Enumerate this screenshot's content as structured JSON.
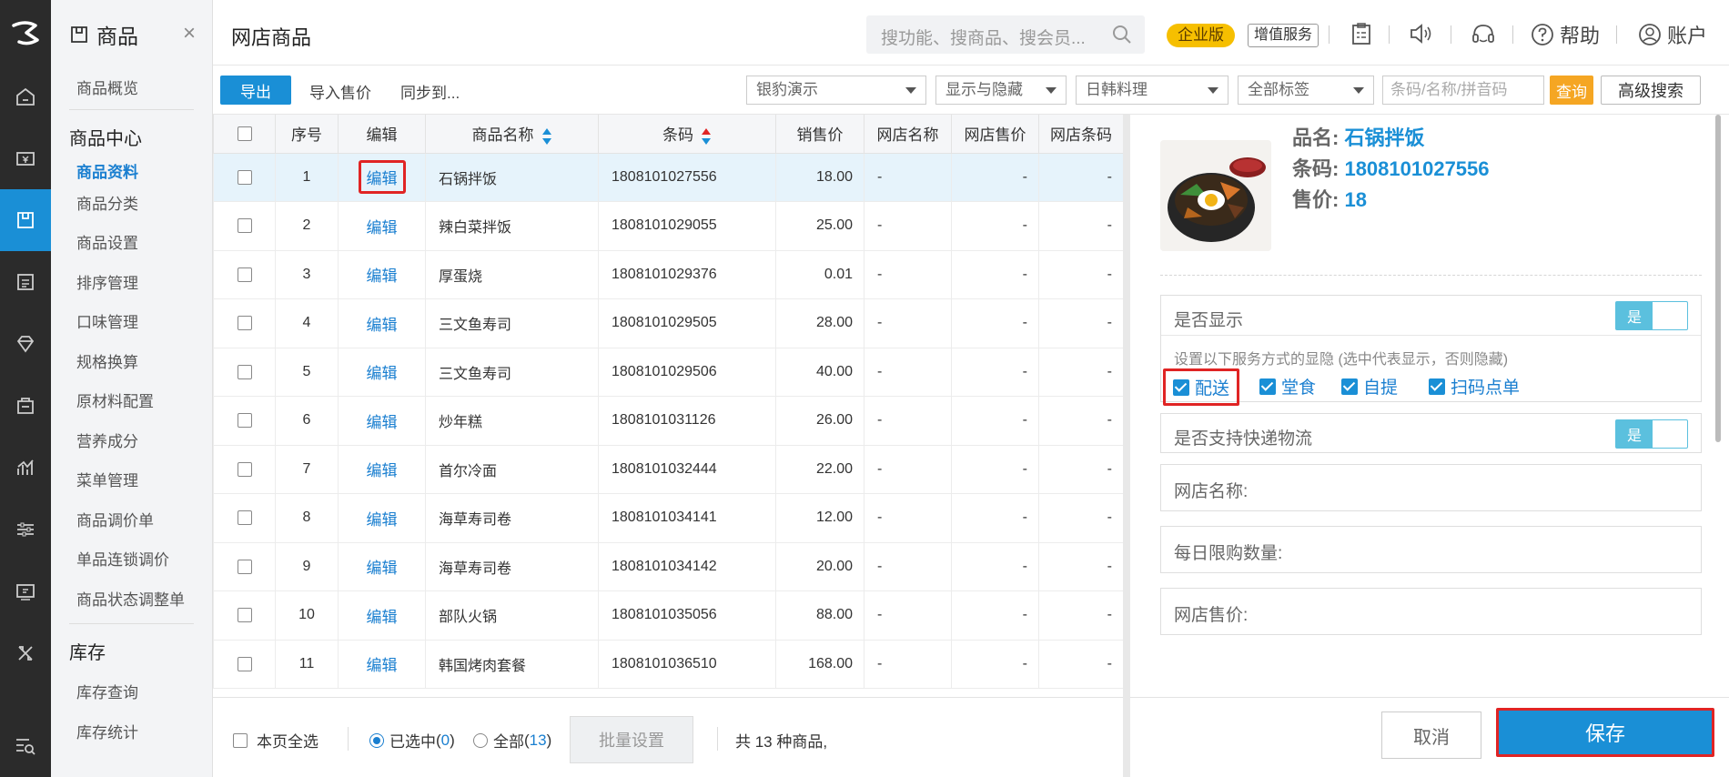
{
  "sidebar": {
    "module_title": "商品",
    "close_glyph": "×",
    "overview": "商品概览",
    "section_goods_center": "商品中心",
    "items": [
      "商品资料",
      "商品分类",
      "商品设置",
      "排序管理",
      "口味管理",
      "规格换算",
      "原材料配置",
      "营养成分",
      "菜单管理",
      "商品调价单",
      "单品连锁调价",
      "商品状态调整单"
    ],
    "active_item": "商品资料",
    "section_inventory": "库存",
    "inventory_items": [
      "库存查询",
      "库存统计"
    ]
  },
  "topbar": {
    "page_title": "网店商品",
    "search_placeholder": "搜功能、搜商品、搜会员...",
    "badge_enterprise": "企业版",
    "badge_value_added": "增值服务",
    "help_label": "帮助",
    "account_label": "账户"
  },
  "toolbar": {
    "export_label": "导出",
    "import_price_label": "导入售价",
    "sync_label": "同步到...",
    "store_select": "银豹演示",
    "visibility_select": "显示与隐藏",
    "category_select": "日韩料理",
    "tag_select": "全部标签",
    "code_placeholder": "条码/名称/拼音码",
    "query_label": "查询",
    "advanced_search_label": "高级搜索"
  },
  "table": {
    "headers": [
      "序号",
      "编辑",
      "商品名称",
      "条码",
      "销售价",
      "网店名称",
      "网店售价",
      "网店条码"
    ],
    "edit_label": "编辑",
    "rows": [
      {
        "no": "1",
        "name": "石锅拌饭",
        "code": "1808101027556",
        "price": "18.00",
        "web_name": "-",
        "web_price": "-",
        "web_code": "-"
      },
      {
        "no": "2",
        "name": "辣白菜拌饭",
        "code": "1808101029055",
        "price": "25.00",
        "web_name": "-",
        "web_price": "-",
        "web_code": "-"
      },
      {
        "no": "3",
        "name": "厚蛋烧",
        "code": "1808101029376",
        "price": "0.01",
        "web_name": "-",
        "web_price": "-",
        "web_code": "-"
      },
      {
        "no": "4",
        "name": "三文鱼寿司",
        "code": "1808101029505",
        "price": "28.00",
        "web_name": "-",
        "web_price": "-",
        "web_code": "-"
      },
      {
        "no": "5",
        "name": "三文鱼寿司",
        "code": "1808101029506",
        "price": "40.00",
        "web_name": "-",
        "web_price": "-",
        "web_code": "-"
      },
      {
        "no": "6",
        "name": "炒年糕",
        "code": "1808101031126",
        "price": "26.00",
        "web_name": "-",
        "web_price": "-",
        "web_code": "-"
      },
      {
        "no": "7",
        "name": "首尔冷面",
        "code": "1808101032444",
        "price": "22.00",
        "web_name": "-",
        "web_price": "-",
        "web_code": "-"
      },
      {
        "no": "8",
        "name": "海草寿司卷",
        "code": "1808101034141",
        "price": "12.00",
        "web_name": "-",
        "web_price": "-",
        "web_code": "-"
      },
      {
        "no": "9",
        "name": "海草寿司卷",
        "code": "1808101034142",
        "price": "20.00",
        "web_name": "-",
        "web_price": "-",
        "web_code": "-"
      },
      {
        "no": "10",
        "name": "部队火锅",
        "code": "1808101035056",
        "price": "88.00",
        "web_name": "-",
        "web_price": "-",
        "web_code": "-"
      },
      {
        "no": "11",
        "name": "韩国烤肉套餐",
        "code": "1808101036510",
        "price": "168.00",
        "web_name": "-",
        "web_price": "-",
        "web_code": "-"
      }
    ]
  },
  "footer": {
    "select_page_label": "本页全选",
    "selected_label": "已选中",
    "selected_count": "0",
    "all_label": "全部",
    "all_count": "13",
    "batch_label": "批量设置",
    "total_text": "共 13 种商品,"
  },
  "detail": {
    "name_label": "品名:",
    "name_value": "石锅拌饭",
    "code_label": "条码:",
    "code_value": "1808101027556",
    "price_label": "售价:",
    "price_value": "18",
    "show_label": "是否显示",
    "show_value": "是",
    "service_hint": "设置以下服务方式的显隐 (选中代表显示，否则隐藏)",
    "services": [
      "配送",
      "堂食",
      "自提",
      "扫码点单"
    ],
    "express_label": "是否支持快递物流",
    "express_value": "是",
    "web_name_label": "网店名称:",
    "daily_limit_label": "每日限购数量:",
    "web_price_label": "网店售价:",
    "cancel_label": "取消",
    "save_label": "保存"
  },
  "colors": {
    "accent": "#1a8fd6",
    "enterprise_badge": "#f6bf00",
    "query_button": "#f5a623",
    "highlight_box": "#e02424",
    "toggle": "#5bc0de"
  }
}
